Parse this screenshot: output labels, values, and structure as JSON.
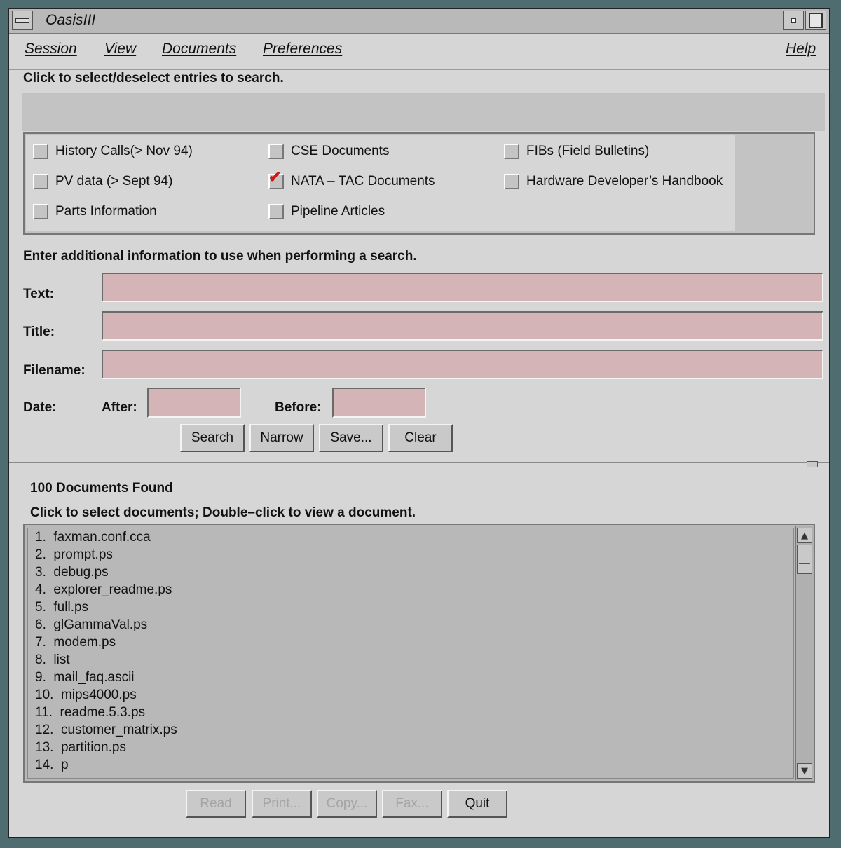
{
  "window": {
    "title": "OasisIII"
  },
  "menu": {
    "session": "Session",
    "view": "View",
    "documents": "Documents",
    "preferences": "Preferences",
    "help": "Help"
  },
  "select_prompt": "Click to select/deselect entries to search.",
  "sources": [
    {
      "label": "History Calls(> Nov 94)",
      "checked": false
    },
    {
      "label": "CSE Documents",
      "checked": false
    },
    {
      "label": "FIBs (Field Bulletins)",
      "checked": false
    },
    {
      "label": "PV data (> Sept 94)",
      "checked": false
    },
    {
      "label": "NATA – TAC Documents",
      "checked": true
    },
    {
      "label": "Hardware Developer’s Handbook",
      "checked": false
    },
    {
      "label": "Parts Information",
      "checked": false
    },
    {
      "label": "Pipeline Articles",
      "checked": false
    }
  ],
  "search_prompt": "Enter additional information to use when performing a search.",
  "fields": {
    "text_label": "Text:",
    "text_value": "",
    "title_label": "Title:",
    "title_value": "",
    "filename_label": "Filename:",
    "filename_value": "",
    "date_label": "Date:",
    "after_label": "After:",
    "after_value": "",
    "before_label": "Before:",
    "before_value": ""
  },
  "search_buttons": {
    "search": "Search",
    "narrow": "Narrow",
    "save": "Save...",
    "clear": "Clear"
  },
  "results": {
    "count_text": "100 Documents Found",
    "instructions": "Click to select documents; Double–click to view a document.",
    "items": [
      "1.  faxman.conf.cca",
      "2.  prompt.ps",
      "3.  debug.ps",
      "4.  explorer_readme.ps",
      "5.  full.ps",
      "6.  glGammaVal.ps",
      "7.  modem.ps",
      "8.  list",
      "9.  mail_faq.ascii",
      "10.  mips4000.ps",
      "11.  readme.5.3.ps",
      "12.  customer_matrix.ps",
      "13.  partition.ps",
      "14.  p"
    ]
  },
  "action_buttons": [
    {
      "label": "Read",
      "enabled": false
    },
    {
      "label": "Print...",
      "enabled": false
    },
    {
      "label": "Copy...",
      "enabled": false
    },
    {
      "label": "Fax...",
      "enabled": false
    },
    {
      "label": "Quit",
      "enabled": true
    }
  ]
}
